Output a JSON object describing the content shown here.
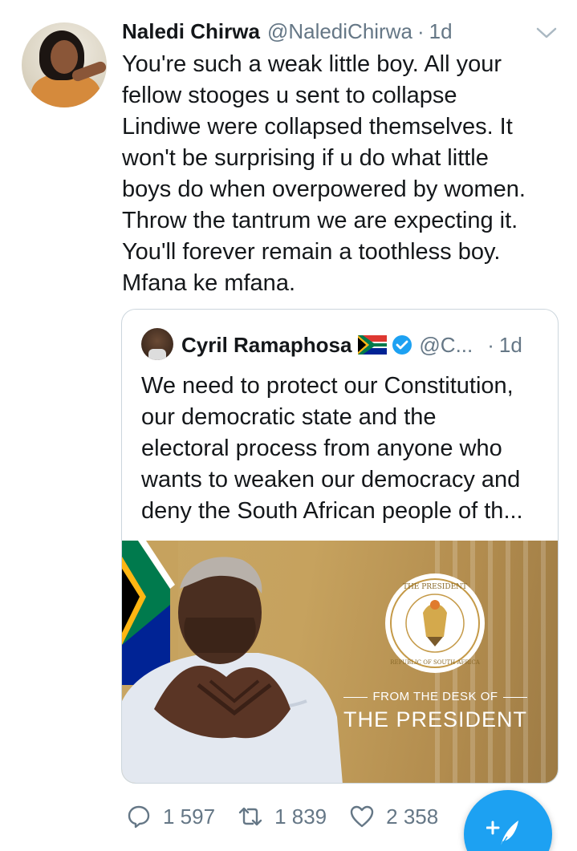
{
  "tweet": {
    "author_name": "Naledi Chirwa",
    "author_handle": "@NalediChirwa",
    "separator": "·",
    "time": "1d",
    "text_lines": [
      "You're such a weak little boy. All your",
      "fellow stooges u sent to collapse",
      "Lindiwe were collapsed themselves. It",
      "won't be surprising if u do what little",
      "boys do when overpowered by women.",
      "Throw the tantrum we are expecting it.",
      "You'll forever remain a toothless boy.",
      "Mfana ke mfana."
    ]
  },
  "quoted": {
    "author_name": "Cyril Ramaphosa",
    "flag_emoji": "🇿🇦",
    "verified": true,
    "author_handle": "@C...",
    "separator": "·",
    "time": "1d",
    "text_lines": [
      "We need to protect our Constitution,",
      "our democratic state and the",
      "electoral process from anyone who",
      "wants to weaken our democracy and",
      "deny the South African people of th..."
    ],
    "image": {
      "tagline": "FROM THE DESK OF",
      "headline": "THE PRESIDENT",
      "seal_text_top": "THE PRESIDENT",
      "seal_text_bottom": "REPUBLIC OF SOUTH AFRICA"
    }
  },
  "actions": {
    "replies": "1 597",
    "retweets": "1 839",
    "likes": "2 358"
  },
  "colors": {
    "accent": "#1da1f2",
    "secondary_text": "#657786",
    "border": "#ccd6dd",
    "image_gold": "#c6a25e"
  },
  "icons": [
    "chevron-down-icon",
    "verified-badge-icon",
    "south-africa-flag-icon",
    "reply-icon",
    "retweet-icon",
    "like-icon",
    "compose-tweet-icon"
  ]
}
